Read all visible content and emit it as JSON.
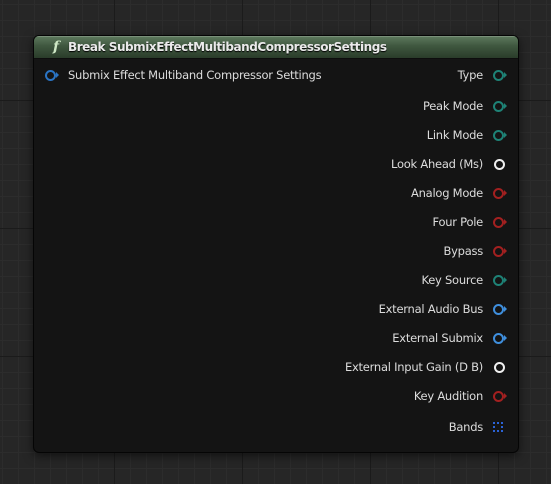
{
  "node": {
    "title": "Break SubmixEffectMultibandCompressorSettings",
    "function_icon_glyph": "f",
    "header_color": "#3f573f",
    "input_pin": {
      "label": "Submix Effect Multiband Compressor Settings",
      "color": "#2a74c4",
      "icon": "struct-pin-icon"
    },
    "output_pins": [
      {
        "label": "Type",
        "color": "#1e8276",
        "icon": "enum-pin-icon"
      },
      {
        "label": "Peak Mode",
        "color": "#1e8276",
        "icon": "enum-pin-icon"
      },
      {
        "label": "Link Mode",
        "color": "#1e8276",
        "icon": "enum-pin-icon"
      },
      {
        "label": "Look Ahead (Ms)",
        "color": "#f0f0f0",
        "icon": "float-pin-icon"
      },
      {
        "label": "Analog Mode",
        "color": "#a32020",
        "icon": "bool-pin-icon"
      },
      {
        "label": "Four Pole",
        "color": "#a32020",
        "icon": "bool-pin-icon"
      },
      {
        "label": "Bypass",
        "color": "#a32020",
        "icon": "bool-pin-icon"
      },
      {
        "label": "Key Source",
        "color": "#1e8276",
        "icon": "enum-pin-icon"
      },
      {
        "label": "External Audio Bus",
        "color": "#3f8fde",
        "icon": "object-pin-icon"
      },
      {
        "label": "External Submix",
        "color": "#3f8fde",
        "icon": "object-pin-icon"
      },
      {
        "label": "External Input Gain (D B)",
        "color": "#f0f0f0",
        "icon": "float-pin-icon"
      },
      {
        "label": "Key Audition",
        "color": "#a32020",
        "icon": "bool-pin-icon"
      },
      {
        "label": "Bands",
        "color": "#2b63d6",
        "icon": "array-pin-icon"
      }
    ]
  }
}
